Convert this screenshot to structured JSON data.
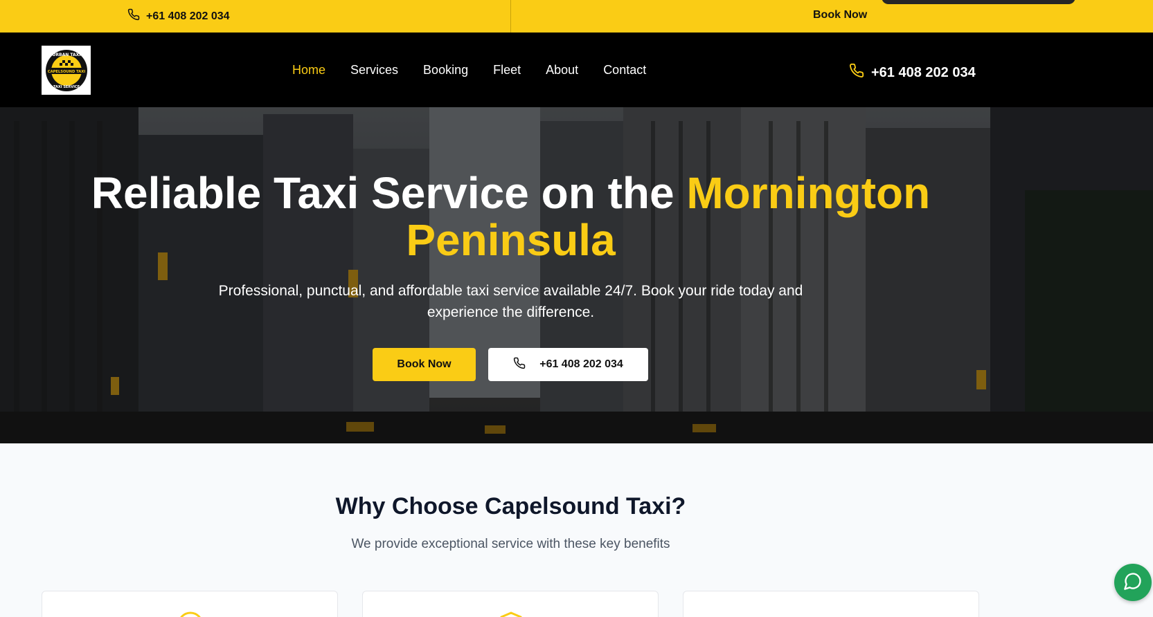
{
  "topbar": {
    "phone": "+61 408 202 034",
    "book_label": "Book Now"
  },
  "logo": {
    "line_top": "URBAN TAXI",
    "line_mid": "CAPELSOUND TAXI",
    "line_bottom": "TAXI SERVICE"
  },
  "nav": {
    "items": [
      "Home",
      "Services",
      "Booking",
      "Fleet",
      "About",
      "Contact"
    ],
    "active": "Home",
    "phone": "+61 408 202 034"
  },
  "hero": {
    "title_plain": "Reliable Taxi Service on the ",
    "title_highlight": "Mornington Peninsula",
    "subtitle": "Professional, punctual, and affordable taxi service available 24/7. Book your ride today and experience the difference.",
    "book_button": "Book Now",
    "call_button": "+61 408 202 034"
  },
  "why": {
    "title": "Why Choose Capelsound Taxi?",
    "subtitle": "We provide exceptional service with these key benefits"
  },
  "colors": {
    "accent": "#facc15",
    "nav_bg": "#000000",
    "chat": "#22a35a"
  },
  "icons": [
    "phone-icon",
    "whatsapp-chat-icon",
    "clock-icon",
    "shield-icon"
  ]
}
